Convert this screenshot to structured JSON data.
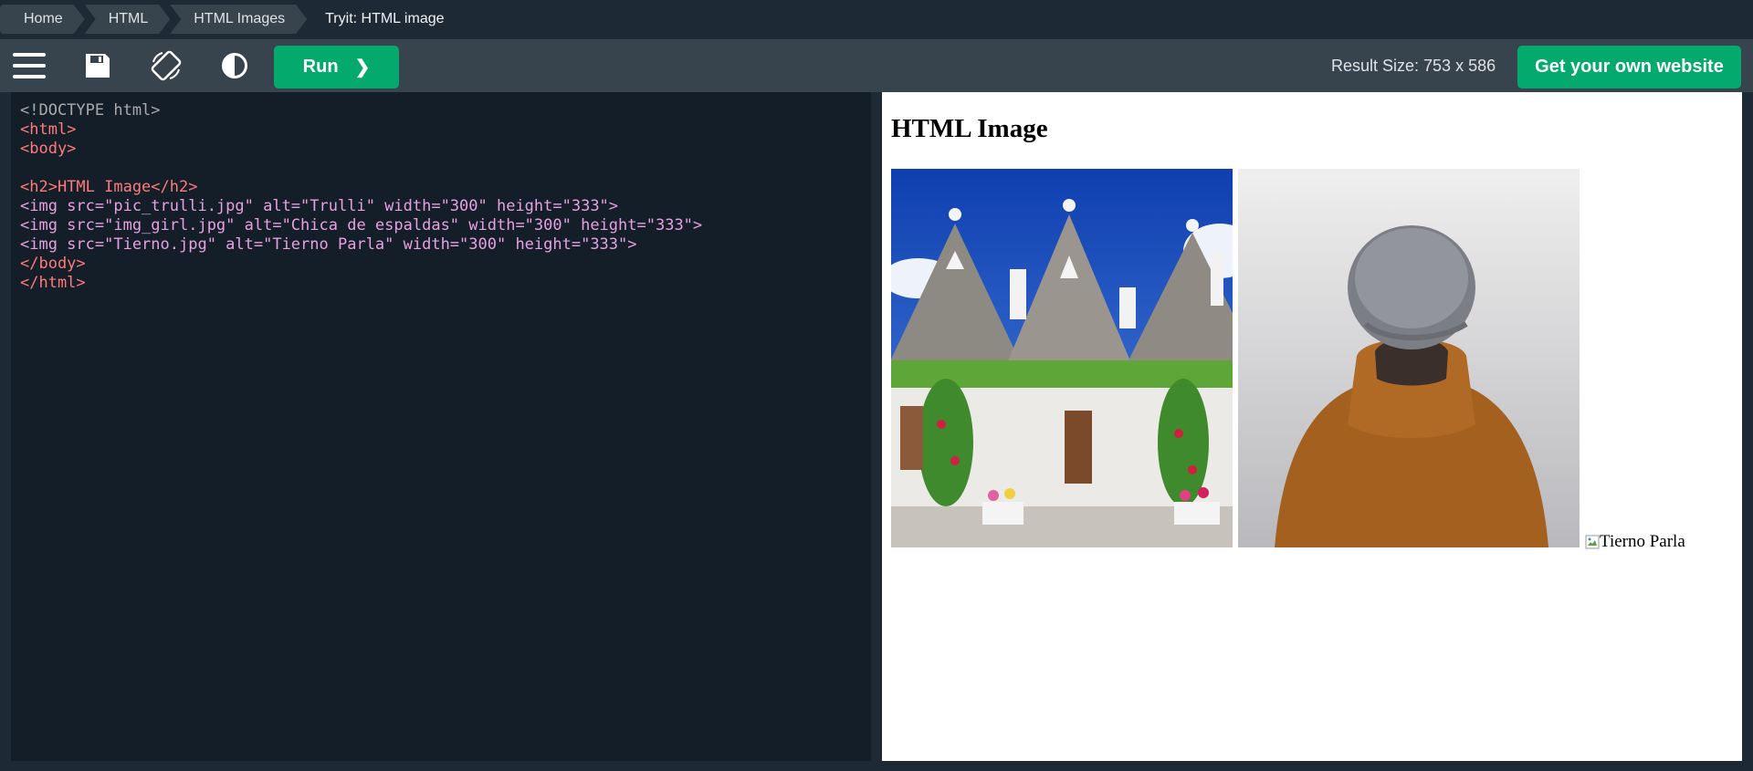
{
  "breadcrumb": {
    "items": [
      "Home",
      "HTML",
      "HTML Images"
    ],
    "current": "Tryit: HTML image"
  },
  "toolbar": {
    "icons": [
      "menu-icon",
      "save-icon",
      "rotate-icon",
      "contrast-icon"
    ],
    "run_label": "Run",
    "run_arrow": "❯",
    "result_size": "Result Size: 753 x 586",
    "get_website_label": "Get your own website",
    "accent": "#04aa6d"
  },
  "editor": {
    "lines": [
      "<!DOCTYPE html>",
      "<html>",
      "<body>",
      "",
      "<h2>HTML Image</h2>",
      "<img src=\"pic_trulli.jpg\" alt=\"Trulli\" width=\"300\" height=\"333\">",
      "<img src=\"img_girl.jpg\" alt=\"Chica de espaldas\" width=\"300\" height=\"333\">",
      "<img src=\"Tierno.jpg\" alt=\"Tierno Parla\" width=\"300\" height=\"333\">",
      "</body>",
      "</html>"
    ],
    "background": "#131e29"
  },
  "result": {
    "heading": "HTML Image",
    "images": [
      {
        "alt": "Trulli",
        "subject": "trulli-houses-photo"
      },
      {
        "alt": "Chica de espaldas",
        "subject": "person-in-beanie-photo"
      }
    ],
    "broken_image_alt": "Tierno Parla"
  }
}
